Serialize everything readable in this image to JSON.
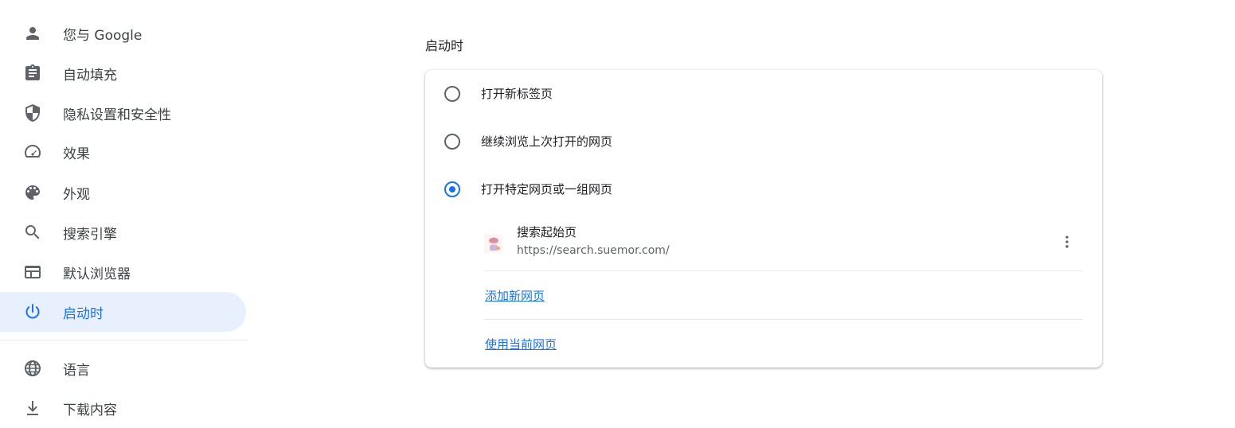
{
  "sidebar": {
    "items": [
      {
        "label": "您与 Google",
        "icon": "person-icon"
      },
      {
        "label": "自动填充",
        "icon": "clipboard-icon"
      },
      {
        "label": "隐私设置和安全性",
        "icon": "shield-icon"
      },
      {
        "label": "效果",
        "icon": "speedometer-icon"
      },
      {
        "label": "外观",
        "icon": "palette-icon"
      },
      {
        "label": "搜索引擎",
        "icon": "search-icon"
      },
      {
        "label": "默认浏览器",
        "icon": "browser-icon"
      },
      {
        "label": "启动时",
        "icon": "power-icon",
        "selected": true
      },
      {
        "label": "语言",
        "icon": "globe-icon"
      },
      {
        "label": "下载内容",
        "icon": "download-icon"
      }
    ]
  },
  "main": {
    "section_title": "启动时",
    "options": [
      {
        "label": "打开新标签页",
        "checked": false
      },
      {
        "label": "继续浏览上次打开的网页",
        "checked": false
      },
      {
        "label": "打开特定网页或一组网页",
        "checked": true
      }
    ],
    "pages": [
      {
        "name": "搜索起始页",
        "url": "https://search.suemor.com/"
      }
    ],
    "add_page_label": "添加新网页",
    "use_current_label": "使用当前网页"
  },
  "colors": {
    "accent": "#1a73e8",
    "selected_bg": "#e8f0fe",
    "text_primary": "#202124",
    "text_secondary": "#5f6368",
    "icon": "#5f6368"
  }
}
